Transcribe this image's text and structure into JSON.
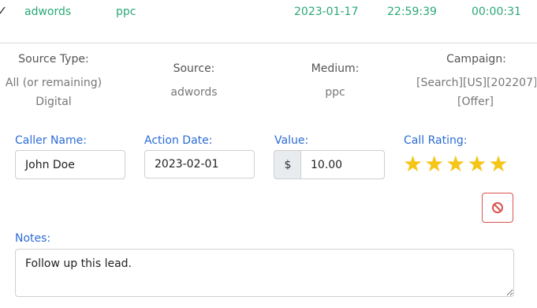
{
  "record": {
    "source": "adwords",
    "medium": "ppc",
    "date": "2023-01-17",
    "time": "22:59:39",
    "duration": "00:00:31"
  },
  "details": {
    "source_type_label": "Source Type:",
    "source_type_value": "All (or remaining)",
    "source_type_value2": "Digital",
    "source_label": "Source:",
    "source_value": "adwords",
    "medium_label": "Medium:",
    "medium_value": "ppc",
    "campaign_label": "Campaign:",
    "campaign_value": "[Search][US][202207]",
    "campaign_value2": "[Offer]"
  },
  "form": {
    "caller_name_label": "Caller Name:",
    "caller_name_value": "John Doe",
    "action_date_label": "Action Date:",
    "action_date_value": "2023-02-01",
    "value_label": "Value:",
    "currency_symbol": "$",
    "value_value": "10.00",
    "call_rating_label": "Call Rating:",
    "rating": 5,
    "rating_max": 5,
    "notes_label": "Notes:",
    "notes_value": "Follow up this lead."
  },
  "icons": {
    "chevron": "chevron-icon",
    "star": "star-icon",
    "clear": "ban-icon"
  },
  "colors": {
    "accent_green": "#2aa876",
    "label_blue": "#2a6bd6",
    "star_gold": "#f5c518",
    "danger_red": "#d9534f"
  }
}
